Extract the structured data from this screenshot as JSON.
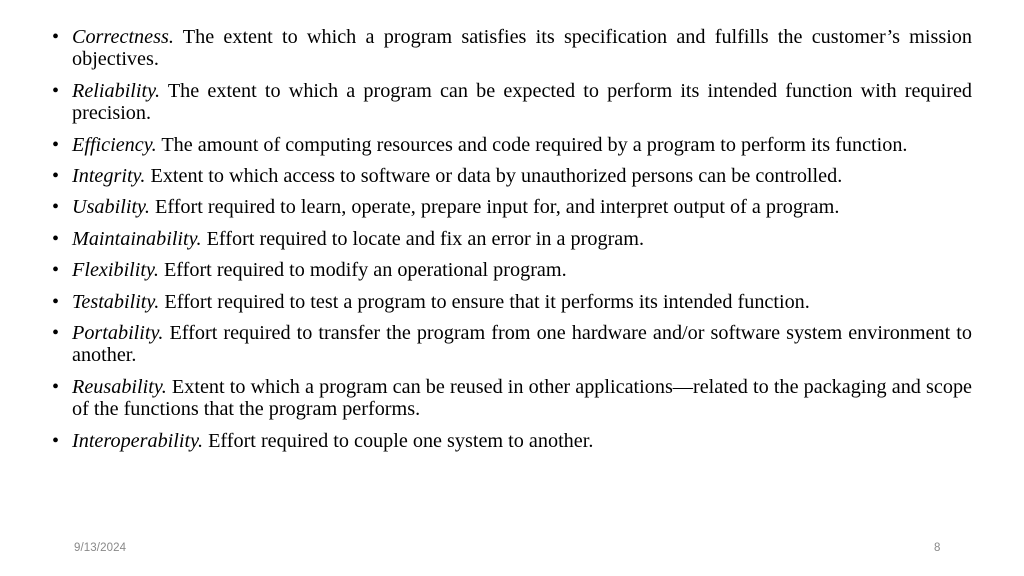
{
  "slide": {
    "bullet_marker": "•",
    "items": [
      {
        "term": "Correctness.",
        "description": "The extent to which a program satisfies its specification and fulfills the customer’s mission objectives.",
        "wraps": true
      },
      {
        "term": "Reliability.",
        "description": "The extent to which a program can be expected to perform its intended function with required precision.",
        "wraps": true
      },
      {
        "term": "Efficiency.",
        "description": "The amount of computing resources and code required by a program to perform its function.",
        "wraps": true
      },
      {
        "term": "Integrity.",
        "description": "Extent to which access to software or data by unauthorized persons can be controlled.",
        "wraps": false
      },
      {
        "term": "Usability.",
        "description": "Effort required to learn, operate, prepare input for, and interpret output of a program.",
        "wraps": false
      },
      {
        "term": "Maintainability.",
        "description": "Effort required to locate and fix an error in a program.",
        "wraps": false
      },
      {
        "term": "Flexibility.",
        "description": "Effort required to modify an operational program.",
        "wraps": false
      },
      {
        "term": "Testability.",
        "description": "Effort required to test a program to ensure that it performs its intended function.",
        "wraps": false
      },
      {
        "term": "Portability.",
        "description": "Effort required to transfer the program from one hardware and/or software system environment to another.",
        "wraps": true
      },
      {
        "term": "Reusability.",
        "description": "Extent to which a program can be reused in other applications—related to the packaging and scope of the functions that the program performs.",
        "wraps": true
      },
      {
        "term": "Interoperability.",
        "description": "Effort required to couple one system to another.",
        "wraps": false
      }
    ]
  },
  "footer": {
    "date": "9/13/2024",
    "page_number": "8"
  },
  "colors": {
    "background": "#ffffff",
    "text": "#000000",
    "footer_text": "#898989"
  }
}
